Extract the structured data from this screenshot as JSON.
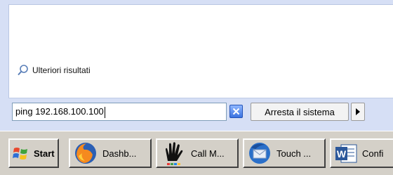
{
  "start_menu": {
    "more_results_label": "Ulteriori risultati",
    "search_value": "ping 192.168.100.100",
    "shutdown_label": "Arresta il sistema"
  },
  "taskbar": {
    "start_label": "Start",
    "tasks": [
      {
        "label": "Dashb...",
        "icon": "firefox-icon"
      },
      {
        "label": "Call M...",
        "icon": "hand-icon"
      },
      {
        "label": "Touch ...",
        "icon": "thunderbird-icon"
      },
      {
        "label": "Confi",
        "icon": "word-icon"
      }
    ]
  },
  "colors": {
    "menu_bg": "#d6dff5",
    "taskbar_bg": "#d4d0c8",
    "clear_button": "#3a72e0"
  }
}
